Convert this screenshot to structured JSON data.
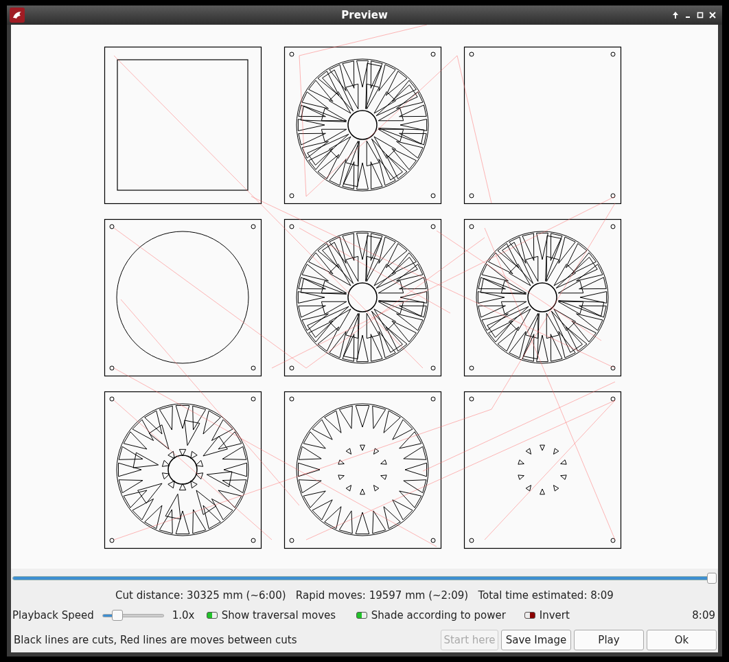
{
  "window": {
    "title": "Preview"
  },
  "preview": {
    "tiles": [
      {
        "kind": "square"
      },
      {
        "kind": "rosette"
      },
      {
        "kind": "blank"
      },
      {
        "kind": "circle"
      },
      {
        "kind": "rosette"
      },
      {
        "kind": "rosette"
      },
      {
        "kind": "teeth"
      },
      {
        "kind": "ring"
      },
      {
        "kind": "star"
      }
    ]
  },
  "progress": {
    "level": 1
  },
  "stats": "Cut distance: 30325 mm (~6:00)   Rapid moves: 19597 mm (~2:09)   Total time estimated: 8:09",
  "playback": {
    "label": "Playback Speed",
    "level": 0.25,
    "reading": "1.0x"
  },
  "toggles": [
    {
      "label": "Show traversal moves",
      "on": true
    },
    {
      "label": "Shade according to power",
      "on": true
    },
    {
      "label": "Invert",
      "on": false
    }
  ],
  "time": "8:09",
  "hint": "Black lines are cuts, Red lines are moves between cuts",
  "buttons": [
    {
      "label": "Start here",
      "disabled": true
    },
    {
      "label": "Save Image",
      "disabled": false
    },
    {
      "label": "Play",
      "disabled": false
    },
    {
      "label": "Ok",
      "disabled": false
    }
  ]
}
